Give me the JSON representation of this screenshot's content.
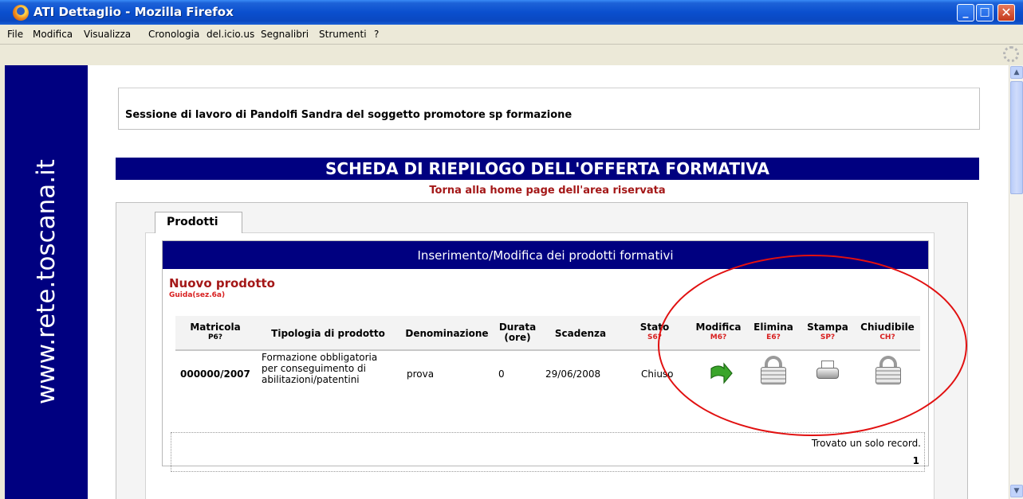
{
  "window": {
    "title": "ATI Dettaglio - Mozilla Firefox",
    "controls": {
      "minimize": "_",
      "maximize": "□",
      "close": "✕"
    }
  },
  "menu": [
    "File",
    "Modifica",
    "Visualizza",
    "Cronologia",
    "del.icio.us",
    "Segnalibri",
    "Strumenti",
    "?"
  ],
  "sidebar": {
    "url": "www.rete.toscana.it"
  },
  "session": {
    "text": "Sessione di lavoro di Pandolfi Sandra del soggetto promotore sp formazione"
  },
  "page": {
    "title": "SCHEDA DI RIEPILOGO DELL'OFFERTA FORMATIVA",
    "home_link": "Torna alla home page dell'area riservata",
    "tab": "Prodotti"
  },
  "section": {
    "header": "Inserimento/Modifica dei prodotti formativi",
    "new_product": "Nuovo prodotto",
    "guide": "Guida(sez.6a)"
  },
  "table": {
    "columns": [
      {
        "label": "Matricola",
        "code": "P6?"
      },
      {
        "label": "Tipologia di prodotto",
        "code": ""
      },
      {
        "label": "Denominazione",
        "code": ""
      },
      {
        "label": "Durata",
        "label2": "(ore)",
        "code": ""
      },
      {
        "label": "Scadenza",
        "code": ""
      },
      {
        "label": "Stato",
        "code": "S6?"
      },
      {
        "label": "Modifica",
        "code": "M6?"
      },
      {
        "label": "Elimina",
        "code": "E6?"
      },
      {
        "label": "Stampa",
        "code": "SP?"
      },
      {
        "label": "Chiudibile",
        "code": "CH?"
      }
    ],
    "row": {
      "matricola": "000000/2007",
      "tipologia": [
        "Formazione obbligatoria",
        "per conseguimento di",
        "abilitazioni/patentini"
      ],
      "denominazione": "prova",
      "durata": "0",
      "scadenza": "29/06/2008",
      "stato": "Chiuso"
    },
    "record_count": "Trovato un solo record.",
    "page": "1"
  },
  "colors": {
    "navy": "#000080",
    "link_red": "#a41818",
    "annotation_red": "#e11010"
  },
  "icons": {
    "modify": "green-arrow-icon",
    "delete": "lock-icon",
    "print": "printer-icon",
    "closable": "lock-icon"
  }
}
